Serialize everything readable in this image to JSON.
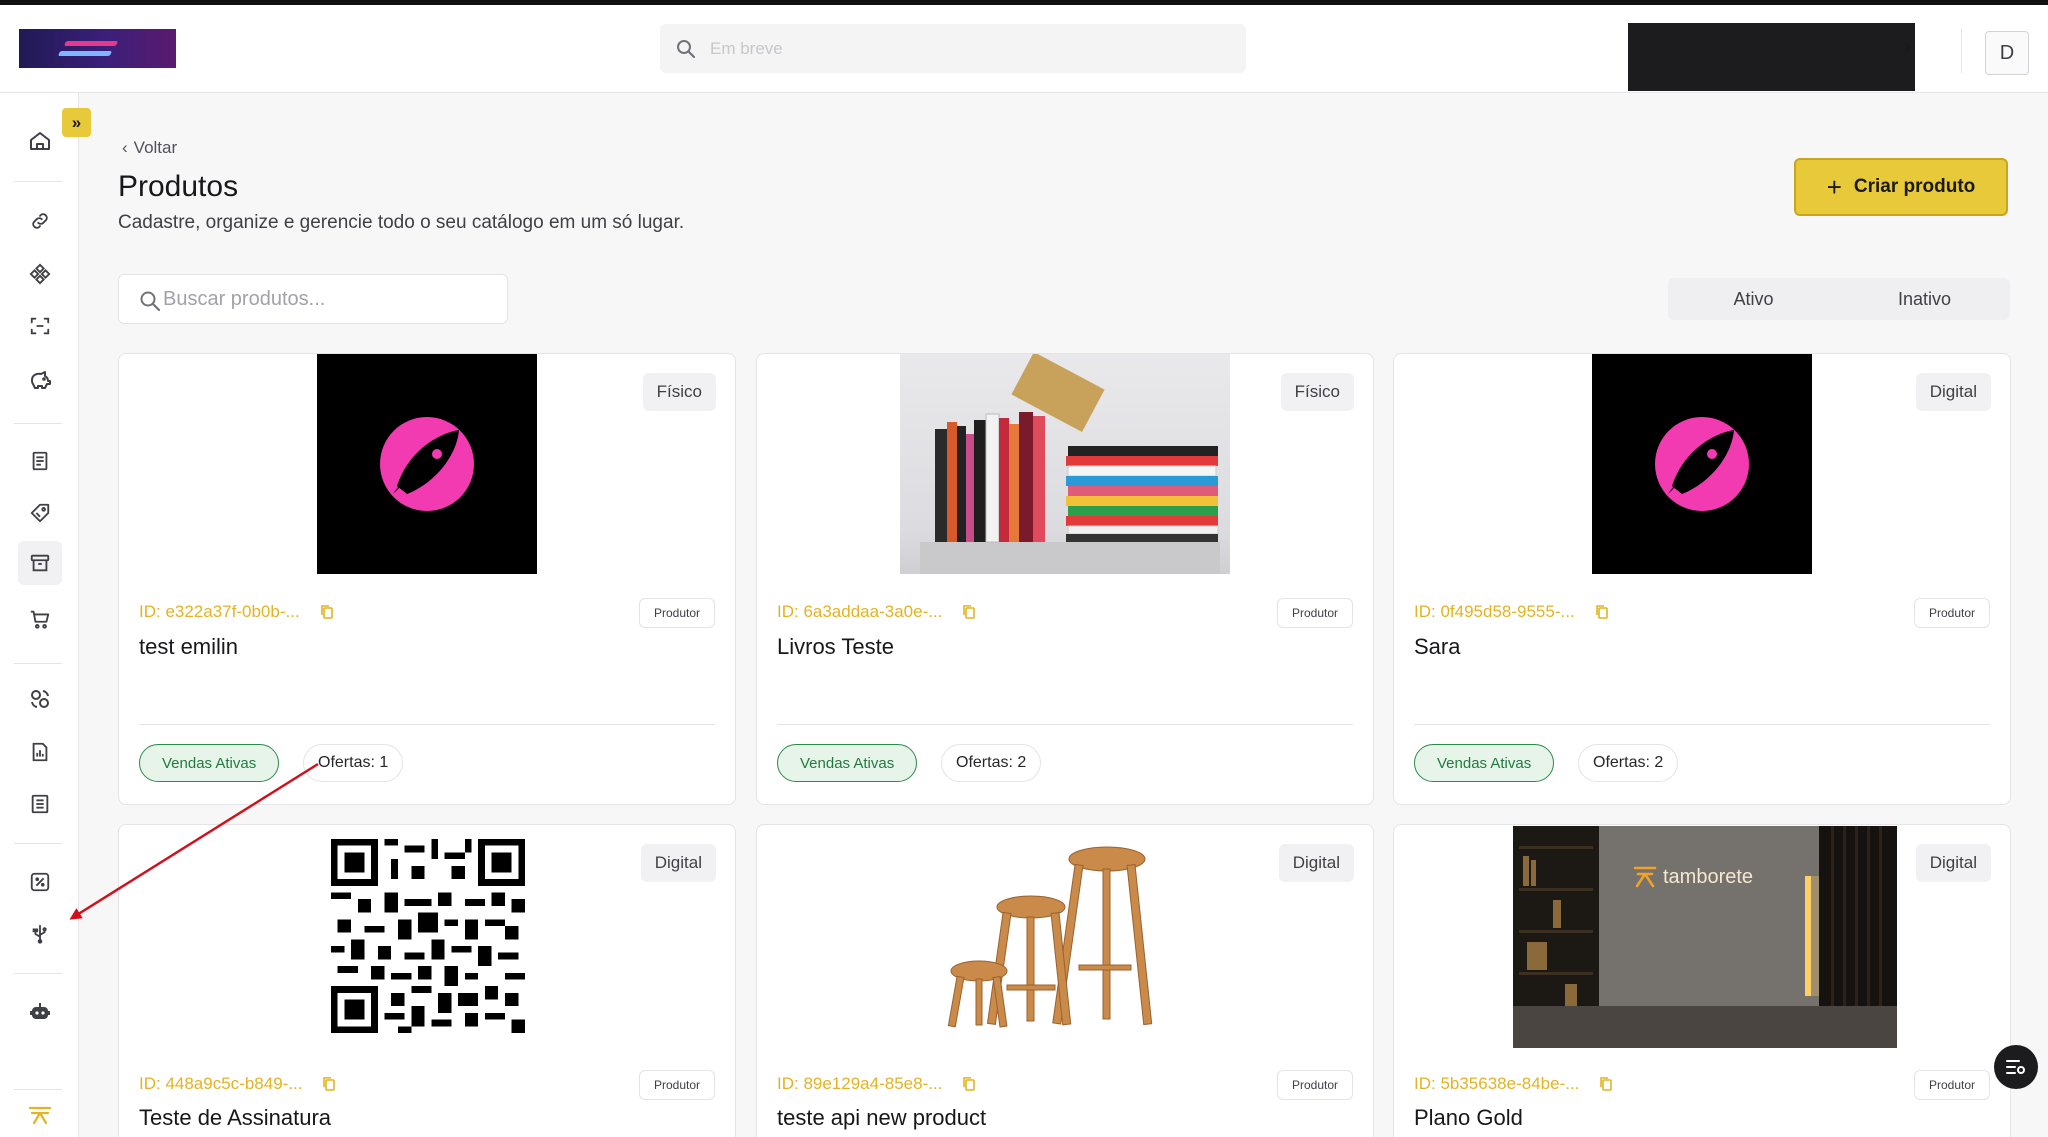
{
  "header": {
    "search_placeholder": "Em breve",
    "avatar_letter": "D"
  },
  "sidebar": {
    "expand_label": "»",
    "icons": [
      "home-icon",
      "link-icon",
      "diamond-grid-icon",
      "scan-icon",
      "piggy-bank-icon",
      "receipt-icon",
      "tag-icon",
      "archive-icon",
      "cart-icon",
      "users-cycle-icon",
      "report-icon",
      "list-icon",
      "percent-icon",
      "usb-icon",
      "bot-icon",
      "logo-mark-icon"
    ]
  },
  "page": {
    "back_label": "Voltar",
    "title": "Produtos",
    "subtitle": "Cadastre, organize e gerencie todo o seu catálogo em um só lugar.",
    "create_label": "Criar produto",
    "search_placeholder": "Buscar produtos...",
    "filter_tabs": [
      "Ativo",
      "Inativo"
    ]
  },
  "products": [
    {
      "type": "Físico",
      "id": "ID: e322a37f-0b0b-...",
      "role": "Produtor",
      "name": "test emilin",
      "sales": "Vendas Ativas",
      "offers": "Ofertas: 1",
      "image": "rocket-logo"
    },
    {
      "type": "Físico",
      "id": "ID: 6a3addaa-3a0e-...",
      "role": "Produtor",
      "name": "Livros Teste",
      "sales": "Vendas Ativas",
      "offers": "Ofertas: 2",
      "image": "books-photo"
    },
    {
      "type": "Digital",
      "id": "ID: 0f495d58-9555-...",
      "role": "Produtor",
      "name": "Sara",
      "sales": "Vendas Ativas",
      "offers": "Ofertas: 2",
      "image": "rocket-logo"
    },
    {
      "type": "Digital",
      "id": "ID: 448a9c5c-b849-...",
      "role": "Produtor",
      "name": "Teste de Assinatura",
      "image": "qr-code"
    },
    {
      "type": "Digital",
      "id": "ID: 89e129a4-85e8-...",
      "role": "Produtor",
      "name": "teste api new product",
      "image": "stools-photo"
    },
    {
      "type": "Digital",
      "id": "ID: 5b35638e-84be-...",
      "role": "Produtor",
      "name": "Plano Gold",
      "image": "tamborete-photo",
      "image_text": "tamborete"
    }
  ],
  "colors": {
    "accent": "#e8c93a",
    "id_text": "#e3b322",
    "sales_green": "#237a40",
    "annotation_arrow": "#d0101a"
  }
}
